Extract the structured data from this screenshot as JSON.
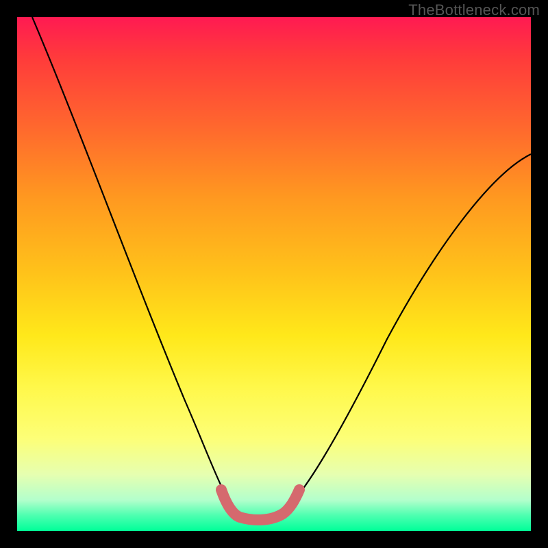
{
  "watermark": "TheBottleneck.com",
  "chart_data": {
    "type": "line",
    "title": "",
    "xlabel": "",
    "ylabel": "",
    "xlim": [
      0,
      100
    ],
    "ylim": [
      0,
      100
    ],
    "series": [
      {
        "name": "bottleneck-curve",
        "x": [
          3,
          10,
          18,
          25,
          30,
          34,
          37,
          40,
          42,
          44,
          46,
          48,
          52,
          58,
          64,
          72,
          82,
          92,
          100
        ],
        "values": [
          100,
          82,
          64,
          47,
          35,
          26,
          18,
          11,
          6,
          3,
          2,
          2,
          3,
          8,
          16,
          28,
          44,
          60,
          72
        ]
      }
    ],
    "annotations": [
      {
        "name": "valley-highlight",
        "x_start": 40,
        "x_end": 52,
        "color": "#d5696e"
      }
    ],
    "background_gradient": {
      "top": "#ff1a52",
      "bottom": "#00ff99",
      "meaning": "high-to-low bottleneck"
    }
  }
}
